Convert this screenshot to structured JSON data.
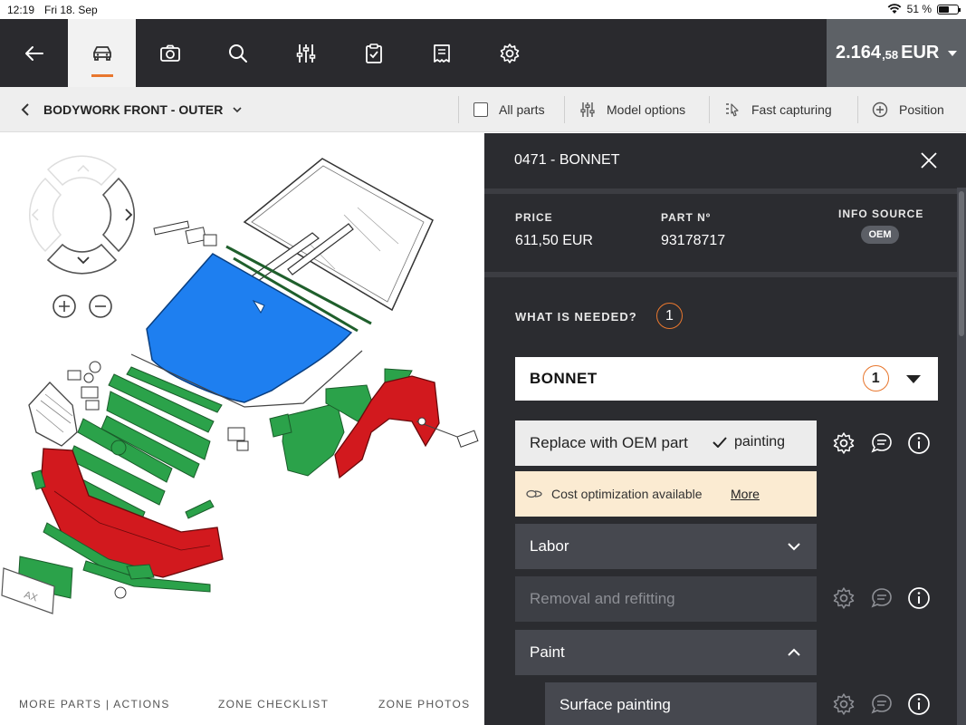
{
  "status_bar": {
    "time": "12:19",
    "date": "Fri 18. Sep",
    "battery": "51 %"
  },
  "toolbar": {
    "icons": [
      "back-arrow-icon",
      "car-icon",
      "camera-icon",
      "search-icon",
      "sliders-icon",
      "clipboard-check-icon",
      "receipt-icon",
      "gear-icon"
    ],
    "active": "car-icon",
    "accent_color": "#e8772e",
    "total": {
      "main": "2.164",
      "decimals": ",58",
      "currency": "EUR"
    }
  },
  "subbar": {
    "zone": "BODYWORK FRONT - OUTER",
    "all_parts": "All parts",
    "model_options": "Model options",
    "fast_capturing": "Fast capturing",
    "position": "Position"
  },
  "bottom_links": {
    "more": "MORE PARTS | ACTIONS",
    "checklist": "ZONE CHECKLIST",
    "photos": "ZONE PHOTOS"
  },
  "diagram": {
    "plate_text": "AX",
    "colors": {
      "selected": "#1e7ff0",
      "green": "#28a745",
      "red": "#d2191e"
    }
  },
  "detail": {
    "title": "0471 - BONNET",
    "price_label": "PRICE",
    "price_value": "611,50 EUR",
    "part_label": "PART Nº",
    "part_value": "93178717",
    "info_label": "INFO SOURCE",
    "info_badge": "OEM",
    "needed_label": "WHAT IS NEEDED?",
    "needed_count": "1",
    "select_value": "BONNET",
    "select_count": "1",
    "replace_label": "Replace with OEM part",
    "painting_label": "painting",
    "cost_text": "Cost optimization available",
    "cost_more": "More",
    "labor_label": "Labor",
    "removal_label": "Removal and refitting",
    "paint_label": "Paint",
    "surface_label": "Surface painting"
  }
}
